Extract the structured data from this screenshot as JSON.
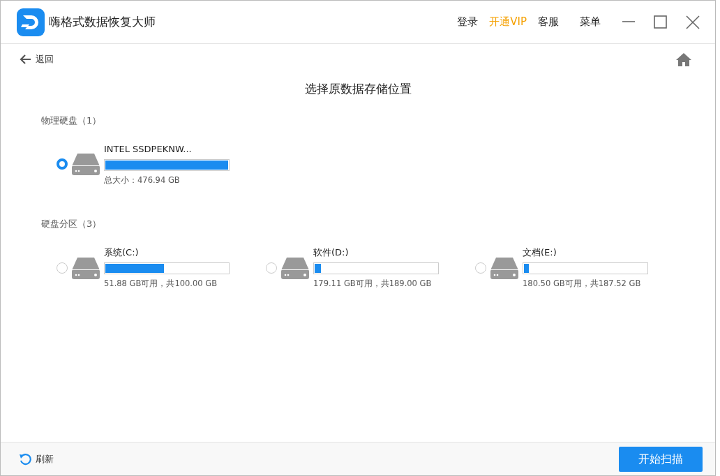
{
  "app": {
    "title": "嗨格式数据恢复大师"
  },
  "header_links": [
    {
      "label": "登录",
      "kind": "normal"
    },
    {
      "label": "开通VIP",
      "kind": "vip"
    },
    {
      "label": "客服",
      "kind": "normal"
    },
    {
      "label": "菜单",
      "kind": "normal"
    }
  ],
  "nav": {
    "back": "返回"
  },
  "heading": "选择原数据存储位置",
  "sections": [
    {
      "title": "物理硬盘（1）",
      "items": [
        {
          "name": "INTEL SSDPEKNW...",
          "level": 1.0,
          "info": "总大小：476.94 GB",
          "selected": true
        }
      ]
    },
    {
      "title": "硬盘分区（3）",
      "items": [
        {
          "name": "系统(C:)",
          "level": 0.48,
          "info": "51.88 GB可用，共100.00 GB",
          "selected": false
        },
        {
          "name": "软件(D:)",
          "level": 0.05,
          "info": "179.11 GB可用，共189.00 GB",
          "selected": false
        },
        {
          "name": "文档(E:)",
          "level": 0.04,
          "info": "180.50 GB可用，共187.52 GB",
          "selected": false
        }
      ]
    }
  ],
  "footer": {
    "refresh": "刷新",
    "scan_button": "开始扫描"
  }
}
